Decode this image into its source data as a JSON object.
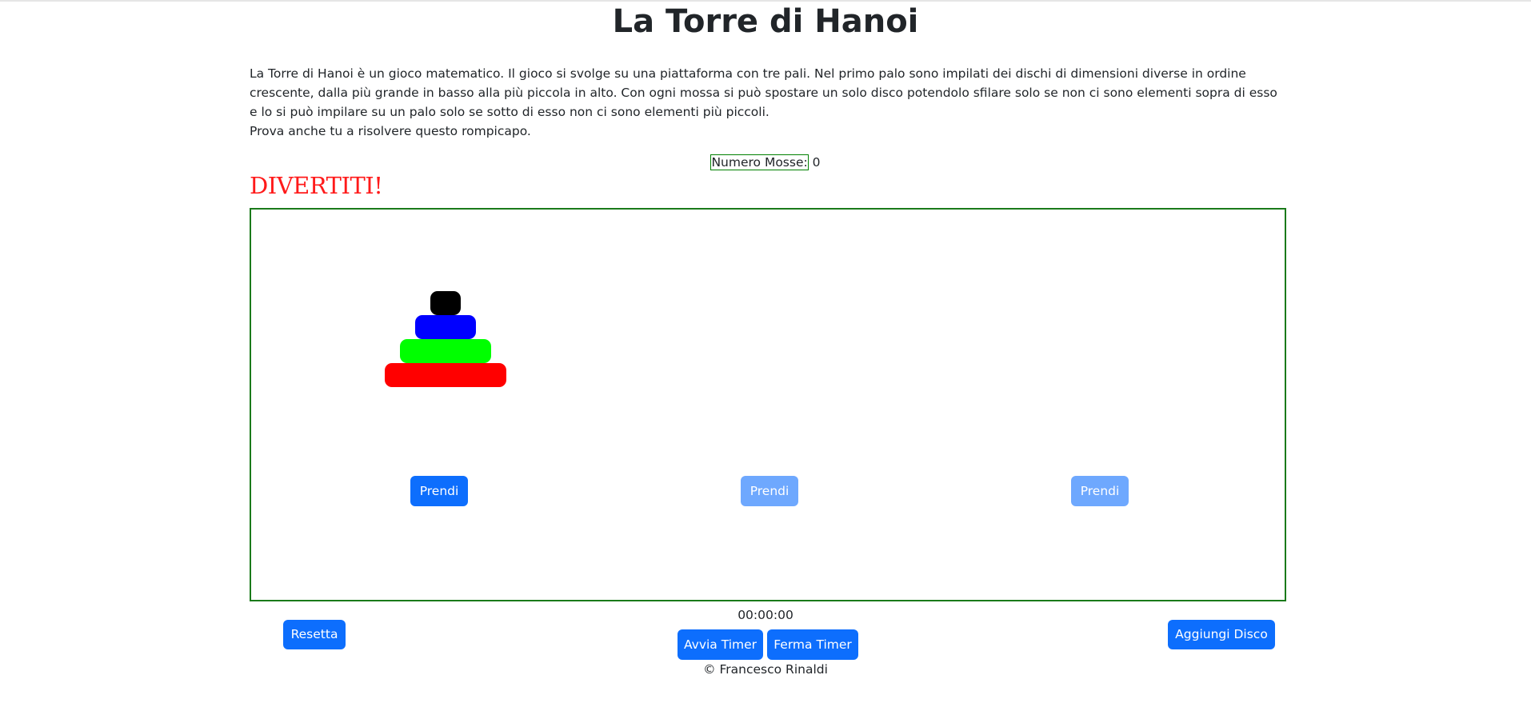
{
  "page": {
    "title": "La Torre di Hanoi",
    "description": [
      "La Torre di Hanoi è un gioco matematico. Il gioco si svolge su una piattaforma con tre pali. Nel primo palo sono impilati dei dischi di dimensioni diverse in ordine crescente, dalla più grande in basso alla più piccola in alto. Con ogni mossa si può spostare un solo disco potendolo sfilare solo se non ci sono elementi sopra di esso e lo si può impilare su un palo solo se sotto di esso non ci sono elementi più piccoli.",
      "Prova anche tu a risolvere questo rompicapo."
    ],
    "moves_label": "Numero Mosse:",
    "moves_value": "0",
    "fun_text": "DIVERTITI!"
  },
  "game": {
    "pegs": [
      {
        "take_label": "Prendi",
        "enabled": true,
        "disks": [
          {
            "color": "#000000"
          },
          {
            "color": "#0000ff"
          },
          {
            "color": "#00ff00"
          },
          {
            "color": "#ff0000"
          }
        ]
      },
      {
        "take_label": "Prendi",
        "enabled": false,
        "disks": []
      },
      {
        "take_label": "Prendi",
        "enabled": false,
        "disks": []
      }
    ]
  },
  "controls": {
    "reset_label": "Resetta",
    "timer_value": "00:00:00",
    "start_timer_label": "Avvia Timer",
    "stop_timer_label": "Ferma Timer",
    "add_disk_label": "Aggiungi Disco"
  },
  "footer": {
    "text": "© Francesco Rinaldi"
  },
  "colors": {
    "primary": "#0d6efd",
    "primary_disabled": "#6ea8fe",
    "board_border": "#1a7a1a",
    "fun_text": "#ff1a1a"
  }
}
